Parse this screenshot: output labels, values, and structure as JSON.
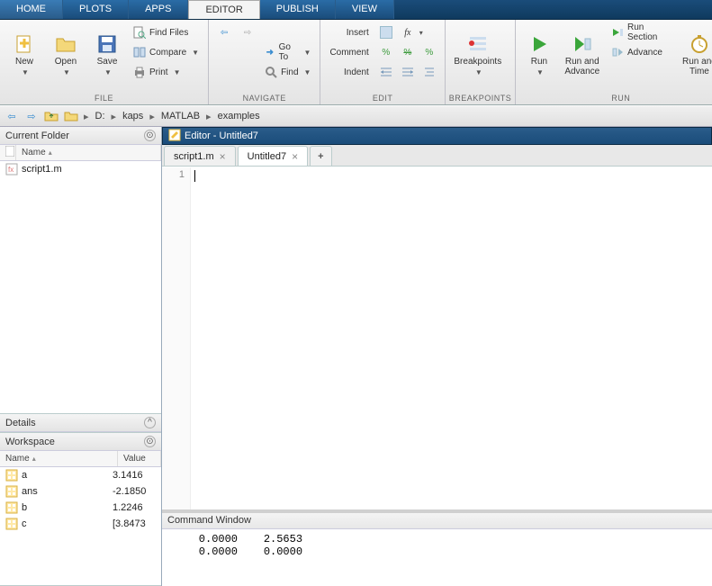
{
  "ribbon_tabs": [
    "HOME",
    "PLOTS",
    "APPS",
    "EDITOR",
    "PUBLISH",
    "VIEW"
  ],
  "ribbon_active": "EDITOR",
  "groups": {
    "file": {
      "label": "FILE",
      "new": "New",
      "open": "Open",
      "save": "Save",
      "find_files": "Find Files",
      "compare": "Compare",
      "print": "Print"
    },
    "navigate": {
      "label": "NAVIGATE",
      "goto": "Go To",
      "find": "Find"
    },
    "edit": {
      "label": "EDIT",
      "insert": "Insert",
      "comment": "Comment",
      "indent": "Indent"
    },
    "breakpoints": {
      "label": "BREAKPOINTS",
      "breakpoints": "Breakpoints"
    },
    "run": {
      "label": "RUN",
      "run": "Run",
      "run_advance": "Run and\nAdvance",
      "run_section": "Run Section",
      "advance": "Advance",
      "run_time": "Run and\nTime"
    }
  },
  "breadcrumbs": [
    "D:",
    "kaps",
    "MATLAB",
    "examples"
  ],
  "current_folder": {
    "title": "Current Folder",
    "col": "Name",
    "files": [
      "script1.m"
    ]
  },
  "details": {
    "title": "Details"
  },
  "workspace": {
    "title": "Workspace",
    "cols": [
      "Name",
      "Value"
    ],
    "vars": [
      {
        "name": "a",
        "value": "3.1416"
      },
      {
        "name": "ans",
        "value": "-2.1850"
      },
      {
        "name": "b",
        "value": "1.2246"
      },
      {
        "name": "c",
        "value": "[3.8473"
      }
    ]
  },
  "editor": {
    "title": "Editor - Untitled7",
    "tabs": [
      {
        "label": "script1.m",
        "active": false
      },
      {
        "label": "Untitled7",
        "active": true
      }
    ],
    "line": "1"
  },
  "command_window": {
    "title": "Command Window",
    "output": "    0.0000    2.5653\n    0.0000    0.0000"
  }
}
